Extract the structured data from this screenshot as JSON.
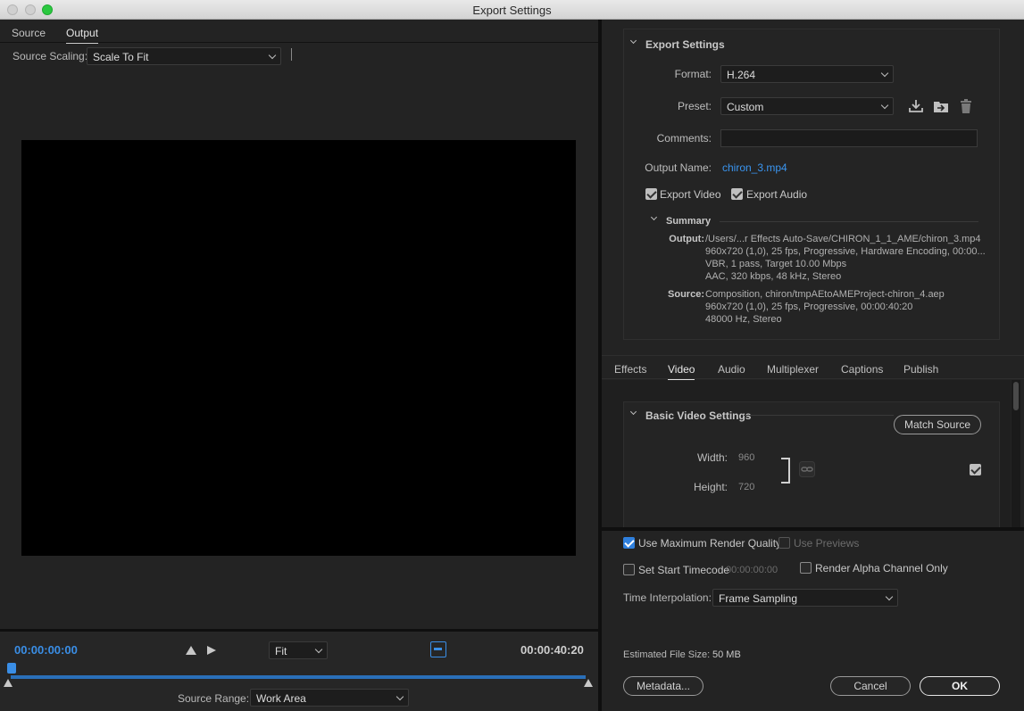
{
  "window": {
    "title": "Export Settings"
  },
  "left": {
    "tabs": [
      {
        "label": "Source"
      },
      {
        "label": "Output"
      }
    ],
    "source_scaling": {
      "label": "Source Scaling:",
      "value": "Scale To Fit"
    },
    "timeline": {
      "current_time": "00:00:00:00",
      "end_time": "00:00:40:20",
      "zoom": "Fit",
      "source_range_label": "Source Range:",
      "source_range_value": "Work Area"
    }
  },
  "export_settings": {
    "header": "Export Settings",
    "format_label": "Format:",
    "format_value": "H.264",
    "preset_label": "Preset:",
    "preset_value": "Custom",
    "comments_label": "Comments:",
    "comments_value": "",
    "output_name_label": "Output Name:",
    "output_name_value": "chiron_3.mp4",
    "export_video_label": "Export Video",
    "export_audio_label": "Export Audio",
    "summary": {
      "header": "Summary",
      "output_label": "Output:",
      "output_lines": [
        "/Users/...r Effects Auto-Save/CHIRON_1_1_AME/chiron_3.mp4",
        "960x720 (1,0), 25 fps, Progressive, Hardware Encoding, 00:00...",
        "VBR, 1 pass, Target 10.00 Mbps",
        "AAC, 320 kbps, 48 kHz, Stereo"
      ],
      "source_label": "Source:",
      "source_lines": [
        "Composition, chiron/tmpAEtoAMEProject-chiron_4.aep",
        "960x720 (1,0), 25 fps, Progressive, 00:00:40:20",
        "48000 Hz, Stereo"
      ]
    }
  },
  "right_tabs": [
    {
      "label": "Effects"
    },
    {
      "label": "Video"
    },
    {
      "label": "Audio"
    },
    {
      "label": "Multiplexer"
    },
    {
      "label": "Captions"
    },
    {
      "label": "Publish"
    }
  ],
  "video_settings": {
    "header": "Basic Video Settings",
    "match_source": "Match Source",
    "width_label": "Width:",
    "width_value": "960",
    "height_label": "Height:",
    "height_value": "720"
  },
  "options": {
    "max_render_quality": "Use Maximum Render Quality",
    "use_previews": "Use Previews",
    "set_start_timecode": "Set Start Timecode",
    "start_timecode_value": "00:00:00:00",
    "render_alpha": "Render Alpha Channel Only",
    "time_interp_label": "Time Interpolation:",
    "time_interp_value": "Frame Sampling",
    "est_size_label": "Estimated File Size:",
    "est_size_value": "50 MB"
  },
  "buttons": {
    "metadata": "Metadata...",
    "cancel": "Cancel",
    "ok": "OK"
  },
  "colors": {
    "accent": "#3a8ee6",
    "background": "#232323",
    "preview": "#000000"
  }
}
